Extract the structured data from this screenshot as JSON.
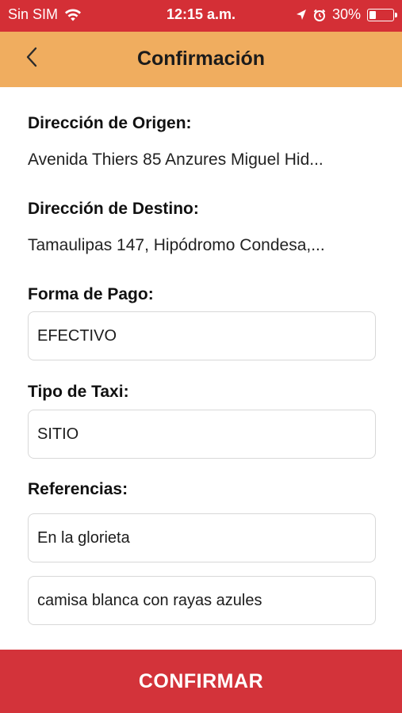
{
  "status_bar": {
    "carrier": "Sin SIM",
    "time": "12:15 a.m.",
    "battery_percent": "30%",
    "battery_level": 0.3,
    "icons": [
      "wifi-icon",
      "location-arrow-icon",
      "alarm-icon",
      "battery-icon"
    ]
  },
  "header": {
    "title": "Confirmación",
    "back_icon": "chevron-left-icon"
  },
  "form": {
    "origin_label": "Dirección de Origen:",
    "origin_value": "Avenida Thiers 85 Anzures Miguel Hid...",
    "destination_label": "Dirección de Destino:",
    "destination_value": "Tamaulipas 147, Hipódromo Condesa,...",
    "payment_label": "Forma de Pago:",
    "payment_value": "EFECTIVO",
    "taxi_type_label": "Tipo de Taxi:",
    "taxi_type_value": "SITIO",
    "references_label": "Referencias:",
    "reference_1": "En la glorieta",
    "reference_2": "camisa blanca con rayas azules"
  },
  "footer": {
    "confirm_label": "CONFIRMAR"
  },
  "colors": {
    "status_bar": "#d42f36",
    "header": "#f0ad5f",
    "confirm_button": "#d3333a"
  }
}
